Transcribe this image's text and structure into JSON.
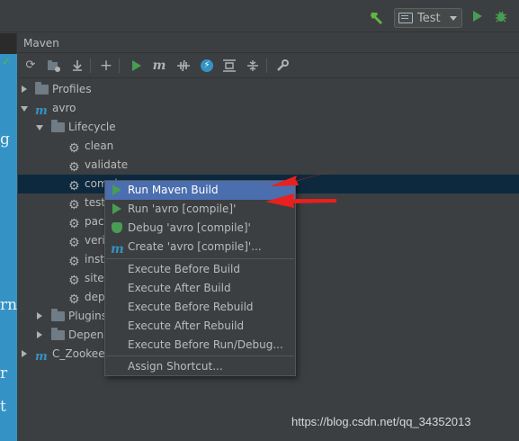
{
  "topbar": {
    "run_config": "Test",
    "icons": [
      "hammer-build-icon",
      "run-config-icon",
      "run-icon",
      "debug-icon"
    ]
  },
  "editor": {
    "fragments": [
      "g",
      "rn",
      "r",
      "t"
    ]
  },
  "panel": {
    "title": "Maven",
    "toolbar_icons": [
      "reload-icon",
      "generate-sources-icon",
      "download-icon",
      "add-icon",
      "run-icon",
      "maven-goal-icon",
      "toggle-offline-icon",
      "skip-tests-icon",
      "show-dependencies-icon",
      "collapse-all-icon",
      "settings-wrench-icon"
    ]
  },
  "tree": {
    "profiles": "Profiles",
    "project": "avro",
    "lifecycle": "Lifecycle",
    "goals": [
      "clean",
      "validate",
      "compi",
      "test",
      "pack",
      "verif",
      "insta",
      "site",
      "dep"
    ],
    "plugins": "Plugins",
    "dependencies": "Depend",
    "other_project": "C_Zookeep"
  },
  "context_menu": {
    "items": [
      {
        "label": "Run Maven Build",
        "icon": "run-icon",
        "highlighted": true
      },
      {
        "label": "Run 'avro [compile]'",
        "icon": "run-icon"
      },
      {
        "label": "Debug 'avro [compile]'",
        "icon": "debug-icon"
      },
      {
        "label": "Create 'avro [compile]'...",
        "icon": "maven-icon"
      },
      {
        "label": "Execute Before Build"
      },
      {
        "label": "Execute After Build"
      },
      {
        "label": "Execute Before Rebuild"
      },
      {
        "label": "Execute After Rebuild"
      },
      {
        "label": "Execute Before Run/Debug..."
      },
      {
        "label": "Assign Shortcut..."
      }
    ]
  },
  "annotation_color": "#e8201e",
  "watermark": "https://blog.csdn.net/qq_34352013"
}
